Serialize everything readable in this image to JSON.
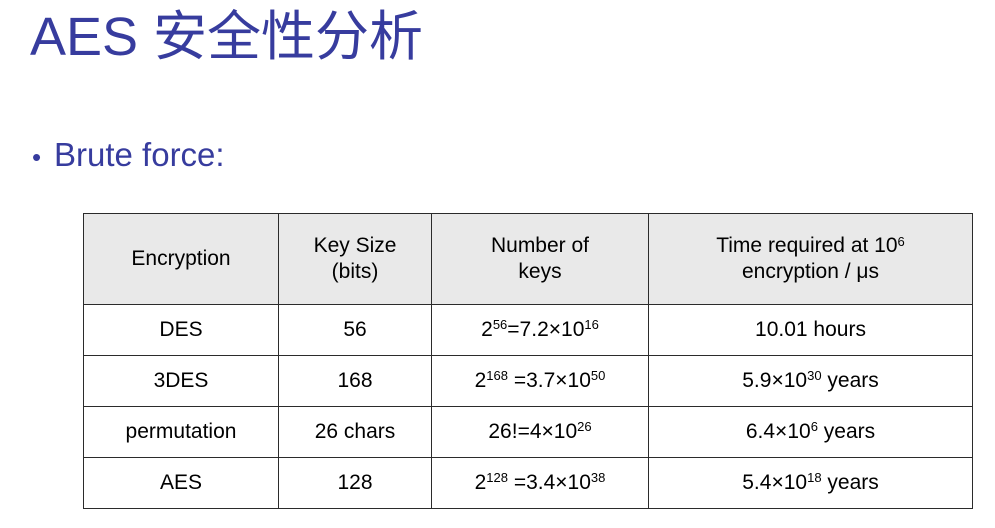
{
  "slide": {
    "title": "AES 安全性分析",
    "title_color": "#373c9e",
    "bullet": {
      "marker": "•",
      "text": "Brute force:"
    }
  },
  "table": {
    "header_bg": "#e9e9e9",
    "border_color": "#2b2b2b",
    "columns": [
      {
        "line1": "Encryption",
        "line2": ""
      },
      {
        "line1": "Key Size",
        "line2": "(bits)"
      },
      {
        "line1": "Number of",
        "line2": "keys"
      },
      {
        "line1": "Time required at 10",
        "line1_sup": "6",
        "line2": "encryption / μs"
      }
    ],
    "rows": [
      {
        "encryption": "DES",
        "key_size": "56",
        "keys": {
          "base": "2",
          "exp": "56",
          "rest": "=7.2×10",
          "rest_exp": "16"
        },
        "time": {
          "text": "10.01 hours"
        }
      },
      {
        "encryption": "3DES",
        "key_size": "168",
        "keys": {
          "base": "2",
          "exp": "168",
          "rest": " =3.7×10",
          "rest_exp": "50"
        },
        "time": {
          "pre": "5.9×10",
          "exp": "30",
          "post": " years"
        }
      },
      {
        "encryption": "permutation",
        "key_size": "26 chars",
        "keys": {
          "base": "26!=4×10",
          "exp": "",
          "rest": "",
          "rest_exp": "26"
        },
        "time": {
          "pre": "6.4×10",
          "exp": "6",
          "post": " years"
        }
      },
      {
        "encryption": "AES",
        "key_size": "128",
        "keys": {
          "base": "2",
          "exp": "128",
          "rest": " =3.4×10",
          "rest_exp": "38"
        },
        "time": {
          "pre": "5.4×10",
          "exp": "18",
          "post": " years"
        }
      }
    ]
  }
}
